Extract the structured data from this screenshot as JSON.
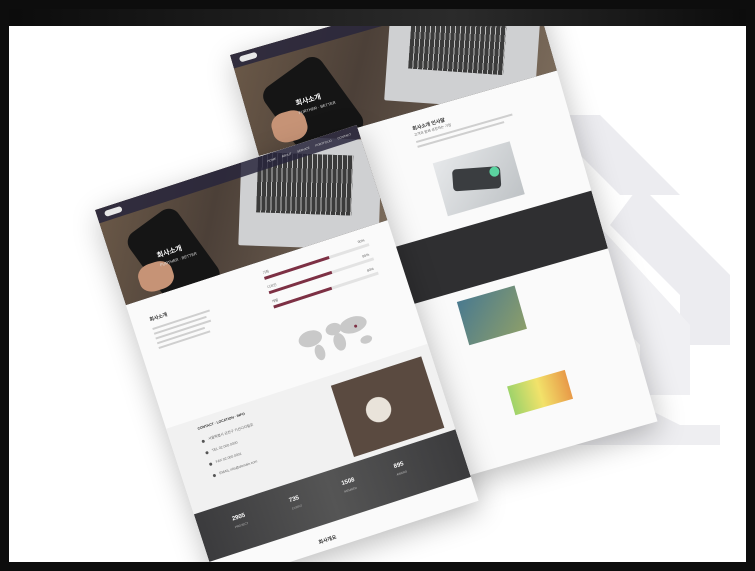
{
  "mock_front": {
    "nav_items": [
      "HOME",
      "ABOUT",
      "SERVICE",
      "PORTFOLIO",
      "CONTACT"
    ],
    "hero_title": "회사소개",
    "hero_sub": "FURTHER · BETTER",
    "about_heading": "회사소개",
    "skills": [
      {
        "label": "기획",
        "value": "90%",
        "fill": 0.62
      },
      {
        "label": "디자인",
        "value": "85%",
        "fill": 0.6
      },
      {
        "label": "개발",
        "value": "80%",
        "fill": 0.55
      }
    ],
    "list_heading": "CONTACT · LOCATION · INFO",
    "list_items": [
      "서울특별시 금천구 가산디지털로",
      "TEL 02.000.0000",
      "FAX 02.000.0001",
      "EMAIL info@domain.com"
    ],
    "stats": [
      {
        "num": "2905",
        "label": "PROJECT"
      },
      {
        "num": "735",
        "label": "CLIENT"
      },
      {
        "num": "1508",
        "label": "MEMBER"
      },
      {
        "num": "895",
        "label": "AWARD"
      }
    ],
    "footer_heading": "회사개요"
  },
  "mock_back": {
    "hero_title": "회사소개",
    "hero_sub": "FURTHER · BETTER",
    "intro_heading": "회사소개 인사말",
    "intro_sub": "고객과 함께 성장하는 기업"
  },
  "colors": {
    "accent": "#7d3044",
    "brand_mark": "#ececf0"
  },
  "icons": [
    "brand-logo-icon",
    "world-map-icon"
  ]
}
